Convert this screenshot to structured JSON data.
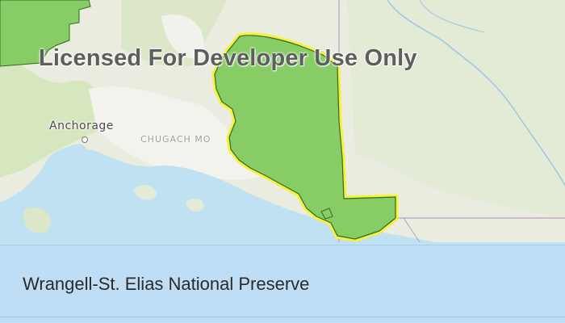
{
  "map": {
    "watermark": "Licensed For Developer Use Only",
    "labels": {
      "city": "Anchorage",
      "mountains": "CHUGACH MO"
    },
    "colors": {
      "land": "#e8ecdd",
      "water": "#bfe1f2",
      "forest": "#cfe3b5",
      "mountain": "#f4f4f0",
      "feature_fill": "#88cc66",
      "feature_selected_outline": "#f7f13a",
      "feature_outline": "#2f6b1f",
      "boundary": "#b79fc8"
    }
  },
  "panel": {
    "feature_name": "Wrangell-St. Elias National Preserve"
  }
}
